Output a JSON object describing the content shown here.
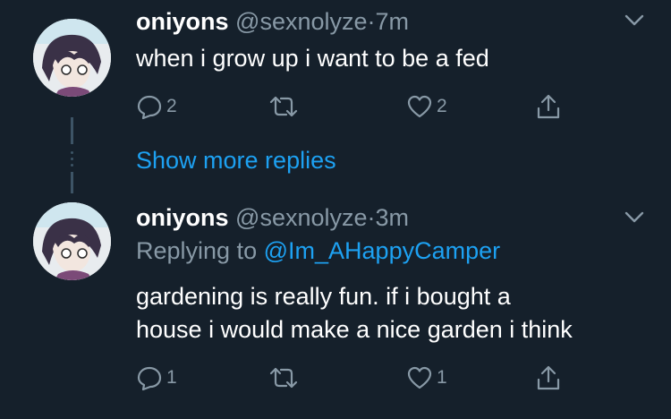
{
  "tweets": [
    {
      "name": "oniyons",
      "handle": "@sexnolyze",
      "separator": "·",
      "time": "7m",
      "text": "when i grow up i want to be a fed",
      "replies": "2",
      "retweets": "",
      "likes": "2"
    },
    {
      "name": "oniyons",
      "handle": "@sexnolyze",
      "separator": "·",
      "time": "3m",
      "replying_prefix": "Replying to",
      "replying_to": "@Im_AHappyCamper",
      "text_line1": "gardening is really fun. if i bought a",
      "text_line2": "house i would make a nice garden i think",
      "replies": "1",
      "retweets": "",
      "likes": "1"
    }
  ],
  "show_more_label": "Show more replies",
  "colors": {
    "background": "#15202b",
    "primary_text": "#ffffff",
    "secondary_text": "#8899a6",
    "accent": "#1da1f2",
    "thread_line": "#3d5466"
  },
  "icons": [
    "reply-icon",
    "retweet-icon",
    "like-icon",
    "share-icon",
    "chevron-down-icon"
  ]
}
